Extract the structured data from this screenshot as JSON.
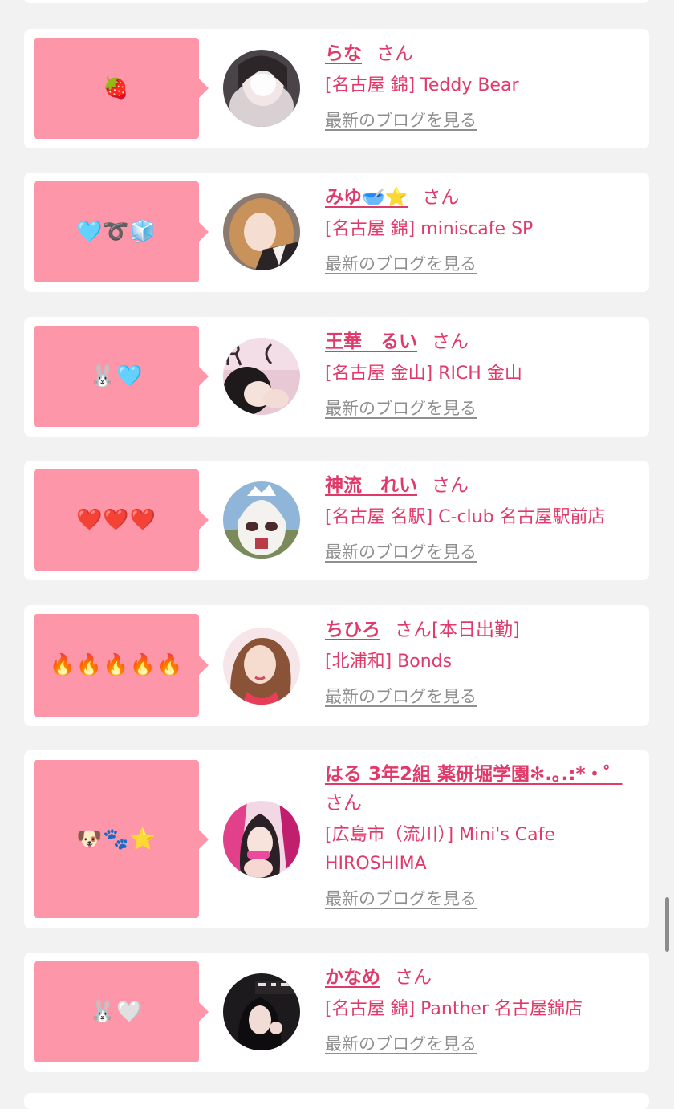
{
  "blog_link_label": "最新のブログを見る",
  "cards": [
    {
      "name": "らな",
      "suffix": "さん",
      "status": "",
      "shop": "[名古屋 錦] Teddy Bear",
      "bubble": "🍓"
    },
    {
      "name": "みゆ🥣⭐️",
      "suffix": "さん",
      "status": "",
      "shop": "[名古屋 錦] miniscafe SP",
      "bubble": "🩵➰🧊"
    },
    {
      "name": "王華　るい",
      "suffix": "さん",
      "status": "",
      "shop": "[名古屋 金山] RICH 金山",
      "bubble": "🐰🩵"
    },
    {
      "name": "神流　れい",
      "suffix": "さん",
      "status": "",
      "shop": "[名古屋 名駅] C-club 名古屋駅前店",
      "bubble": "❤️❤️❤️"
    },
    {
      "name": "ちひろ",
      "suffix": "さん",
      "status": "[本日出勤]",
      "shop": "[北浦和] Bonds",
      "bubble": "🔥🔥🔥🔥🔥"
    },
    {
      "name": "はる 3年2組 薬研堀学園✻.｡.:*・゜",
      "suffix": "さん",
      "status": "",
      "shop": "[広島市（流川）] Mini's Cafe HIROSHIMA",
      "bubble": "🐶🐾⭐️"
    },
    {
      "name": "かなめ",
      "suffix": "さん",
      "status": "",
      "shop": "[名古屋 錦] Panther 名古屋錦店",
      "bubble": "🐰🤍"
    }
  ]
}
